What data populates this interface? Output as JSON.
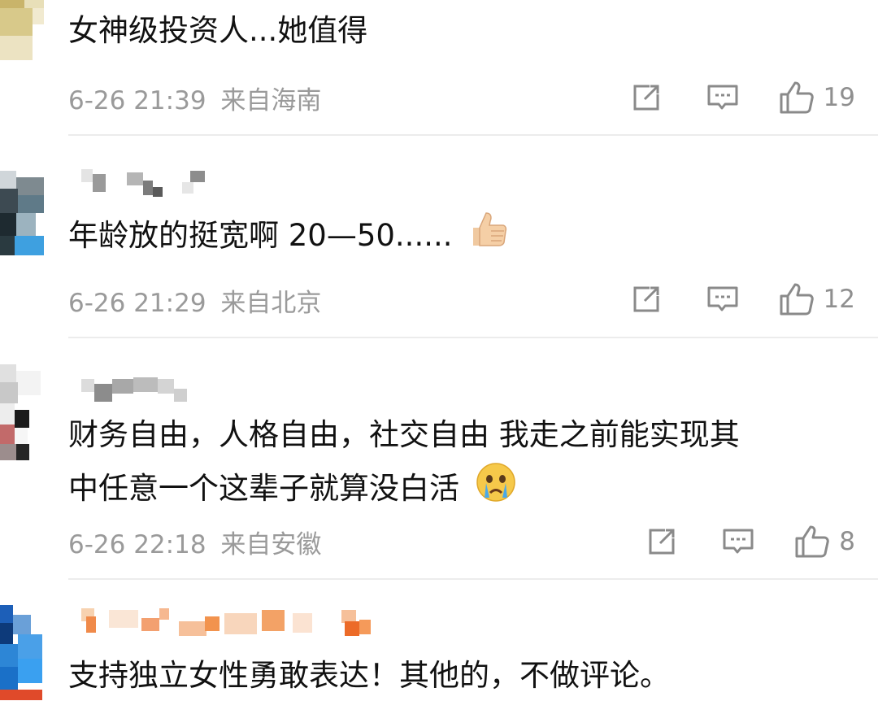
{
  "comments": [
    {
      "text": "女神级投资人...她值得",
      "time": "6-26 21:39",
      "location": "来自海南",
      "likes": "19"
    },
    {
      "text": "年龄放的挺宽啊   20—50......",
      "time": "6-26 21:29",
      "location": "来自北京",
      "likes": "12",
      "emoji": "thumbs-up-emoji"
    },
    {
      "text_line1": "财务自由，人格自由，社交自由 我走之前能实现其",
      "text_line2": "中任意一个这辈子就算没白活",
      "time": "6-26 22:18",
      "location": "来自安徽",
      "likes": "8",
      "emoji": "crying-face-emoji"
    },
    {
      "text": "支持独立女性勇敢表达！其他的，不做评论。"
    }
  ],
  "icons": [
    "share-icon",
    "comment-icon",
    "like-icon"
  ],
  "colors": {
    "meta_gray": "#9a9a9a",
    "divider": "#ececec",
    "icon_gray": "#8a8a8a"
  }
}
